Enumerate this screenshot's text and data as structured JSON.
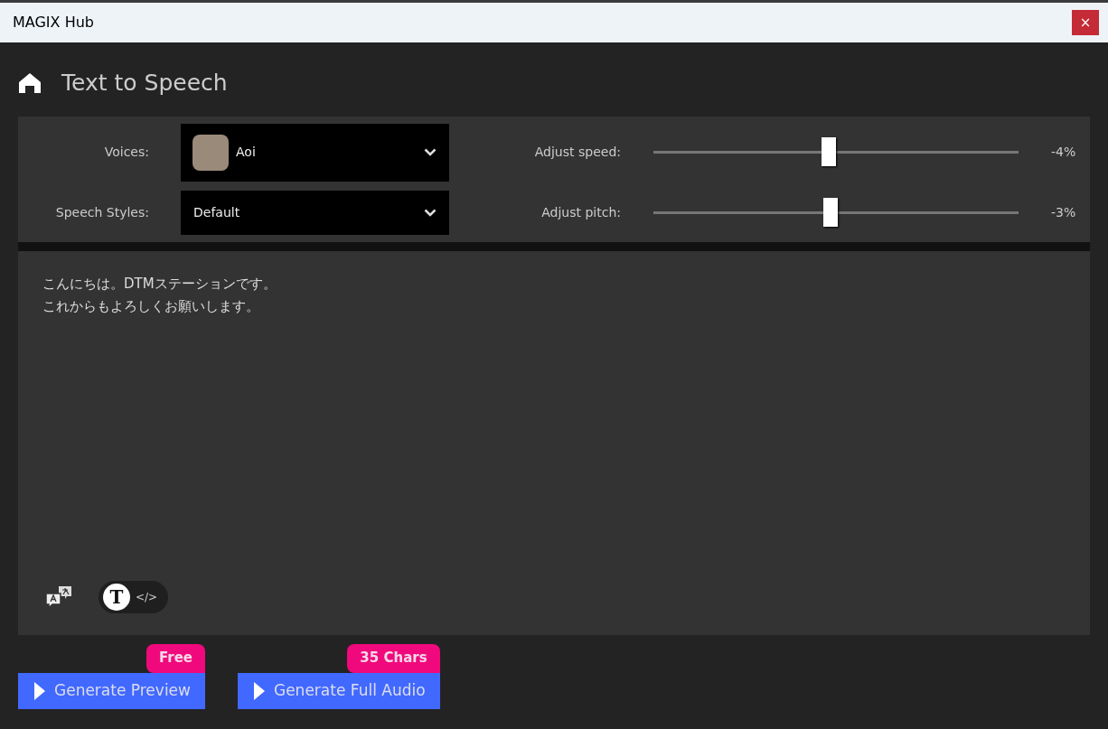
{
  "window": {
    "title": "MAGIX Hub",
    "close_label": "×"
  },
  "page_title": "Text to Speech",
  "settings": {
    "voice": {
      "label": "Voices:",
      "value": "Aoi"
    },
    "style": {
      "label": "Speech Styles:",
      "value": "Default"
    },
    "sliders": [
      {
        "label": "Adjust speed:",
        "level": 0.48,
        "reading": "-4%"
      },
      {
        "label": "Adjust pitch:",
        "level": 0.485,
        "reading": "-3%"
      }
    ]
  },
  "text_input": {
    "lines": [
      "こんにちは。DTMステーションです。",
      "これからもよろしくお願いします。"
    ]
  },
  "text_mode_toggle": [
    {
      "label": "T",
      "selected": true
    },
    {
      "label": "</>",
      "selected": false
    }
  ],
  "buttons": [
    {
      "label": "Generate Preview",
      "badge": "Free"
    },
    {
      "label": "Generate Full Audio",
      "badge": "35 Chars"
    }
  ]
}
